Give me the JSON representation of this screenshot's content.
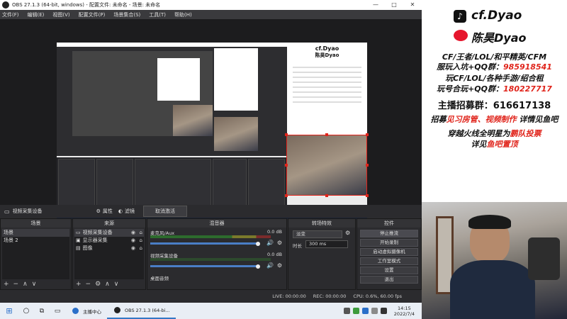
{
  "titlebar": {
    "title": "OBS 27.1.3 (64-bit, windows) - 配置文件: 未命名 - 场景: 未命名",
    "minimize": "—",
    "maximize": "□",
    "close": "✕"
  },
  "menubar": [
    "文件(F)",
    "编辑(E)",
    "视图(V)",
    "配置文件(P)",
    "场景集合(S)",
    "工具(T)",
    "帮助(H)"
  ],
  "source_bar": {
    "selected_source": "视频采集设备",
    "properties": "属性",
    "filters": "滤镜",
    "deactivate": "取消激活"
  },
  "docks": {
    "scenes": {
      "title": "场景",
      "items": [
        "场景",
        "场景 2"
      ]
    },
    "sources": {
      "title": "来源",
      "items": [
        "视频采集设备",
        "显示器采集",
        "图像"
      ]
    },
    "mixer": {
      "title": "混音器",
      "channels": [
        {
          "name": "麦克风/Aux",
          "db": "0.0 dB"
        },
        {
          "name": "视频采集设备",
          "db": "0.0 dB"
        },
        {
          "name": "桌面音频",
          "db": "0.0 dB"
        }
      ]
    },
    "transitions": {
      "title": "转场特效",
      "selected": "淡变",
      "duration_label": "时长",
      "duration_value": "300 ms"
    },
    "controls": {
      "title": "控件",
      "buttons": [
        "停止推流",
        "开始录制",
        "启动虚拟摄像机",
        "工作室模式",
        "设置",
        "退出"
      ]
    }
  },
  "statusbar": {
    "live": "LIVE: 00:00:00",
    "rec": "REC: 00:00:00",
    "cpu": "CPU: 0.6%, 60.00 fps"
  },
  "taskbar": {
    "app1": "主播中心",
    "app2": "OBS 27.1.3 (64-bi...",
    "time": "14:15",
    "date": "2022/7/4"
  },
  "overlay": {
    "handle1": "cf.Dyao",
    "handle2": "陈昊Dyao",
    "line1": "CF/王者/LOL/和平精英/CFM",
    "line2_label": "服玩入坑+QQ群：",
    "line2_value": "985918541",
    "line3": "玩CF/LOL/各种手游/绍合租",
    "line4_label": "玩号合玩+QQ群：",
    "line4_value": "180227717",
    "line5_label": "主播招募群：",
    "line5_value": "616617138",
    "line6_a": "招募",
    "line6_b": "见习房管、视频制作",
    "line6_c": "详情见鱼吧",
    "line7_a": "穿越火线全明星为",
    "line7_b": "鹏队投票",
    "line8_a": "详见",
    "line8_b": "鱼吧置顶"
  },
  "colors": {
    "accent_red": "#e0241b",
    "obs_bg": "#2b2b2e",
    "overlay_text": "#111111"
  }
}
